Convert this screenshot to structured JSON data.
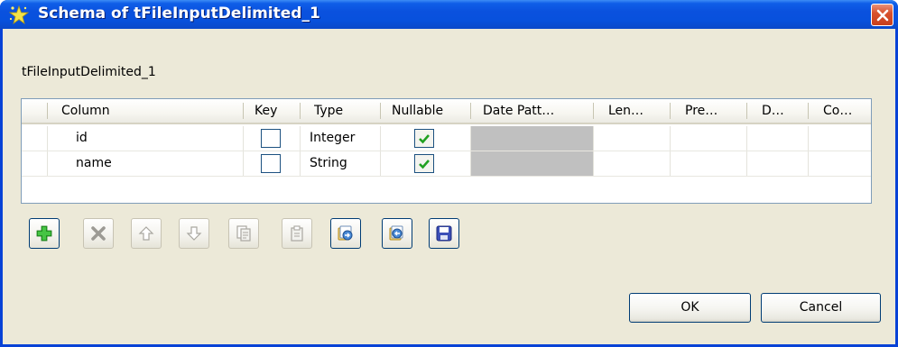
{
  "window": {
    "title": "Schema of tFileInputDelimited_1"
  },
  "component_label": "tFileInputDelimited_1",
  "table": {
    "columns": [
      "Column",
      "Key",
      "Type",
      "Nullable",
      "Date Patt…",
      "Len…",
      "Pre…",
      "D…",
      "Co…"
    ],
    "rows": [
      {
        "column": "id",
        "key": false,
        "type": "Integer",
        "nullable": true
      },
      {
        "column": "name",
        "key": false,
        "type": "String",
        "nullable": true
      }
    ]
  },
  "toolbar": {
    "buttons": [
      {
        "icon": "add-icon",
        "enabled": true
      },
      {
        "icon": "remove-icon",
        "enabled": false
      },
      {
        "icon": "move-up-icon",
        "enabled": false
      },
      {
        "icon": "move-down-icon",
        "enabled": false
      },
      {
        "icon": "copy-icon",
        "enabled": false
      },
      {
        "icon": "paste-icon",
        "enabled": false
      },
      {
        "icon": "import-icon",
        "enabled": true
      },
      {
        "icon": "export-icon",
        "enabled": true
      },
      {
        "icon": "save-icon",
        "enabled": true
      }
    ]
  },
  "buttons": {
    "ok": "OK",
    "cancel": "Cancel"
  },
  "colors": {
    "titlebar": "#0851dd",
    "dialog_bg": "#ece9d8",
    "close": "#d9522e",
    "check": "#21a121",
    "add": "#2aa629"
  }
}
